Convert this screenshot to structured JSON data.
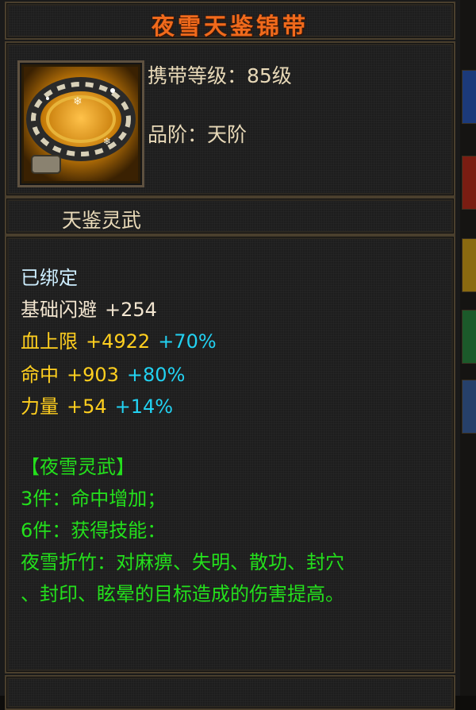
{
  "item": {
    "name": "夜雪天鉴锦带",
    "carry_level": "携带等级：85级",
    "grade": "品阶：天阶",
    "category": "天鉴灵武",
    "icon": "belt-icon"
  },
  "stats": {
    "bound": "已绑定",
    "lines": [
      {
        "name": "基础闪避",
        "value": "+254",
        "bonus": ""
      },
      {
        "name": "血上限",
        "value": "+4922",
        "bonus": "+70%"
      },
      {
        "name": "命中",
        "value": "+903",
        "bonus": "+80%"
      },
      {
        "name": "力量",
        "value": "+54",
        "bonus": "+14%"
      }
    ]
  },
  "set": {
    "title": "【夜雪灵武】",
    "bonus_3": "3件：命中增加；",
    "bonus_6": "6件：获得技能：",
    "skill_line1": "夜雪折竹：对麻痹、失明、散功、封穴",
    "skill_line2": "、封印、眩晕的目标造成的伤害提高。"
  },
  "colors": {
    "title": "#f06a1c",
    "base_text": "#f2e5d0",
    "gold_text": "#ffcf1f",
    "cyan_text": "#22d2f2",
    "green_text": "#24e01c",
    "bound_text": "#cdeeff"
  }
}
